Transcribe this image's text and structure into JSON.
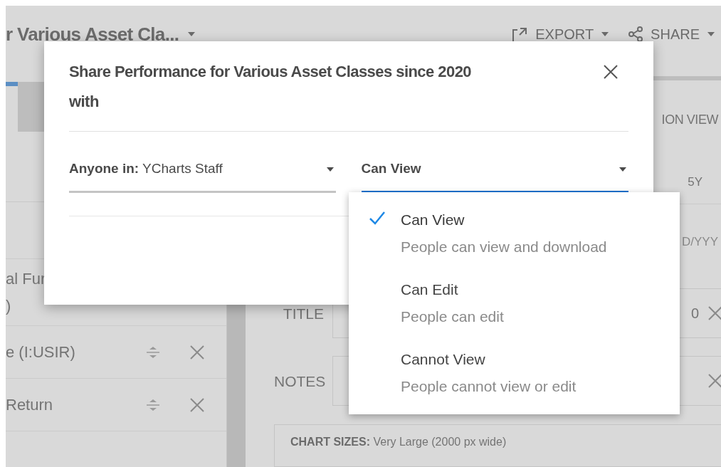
{
  "page": {
    "title": "r Various Asset Cla...",
    "actions": [
      {
        "kind": "export",
        "label": "EXPORT"
      },
      {
        "kind": "share",
        "label": "SHARE"
      }
    ]
  },
  "left_panel": {
    "rows": [
      {
        "lines": [
          "al Fur",
          ")"
        ],
        "controls": false
      },
      {
        "lines": [
          "e (I:USIR)"
        ],
        "controls": true
      },
      {
        "lines": [
          "Return"
        ],
        "controls": true
      }
    ]
  },
  "right_panel": {
    "view_label": "ION VIEW",
    "period": "5Y",
    "date_placeholder": "D/YYY",
    "fields": [
      {
        "label": "TITLE",
        "value": "0"
      },
      {
        "label": "NOTES"
      }
    ],
    "chart_sizes": {
      "label": "CHART SIZES:",
      "value": "Very Large (2000 px wide)"
    }
  },
  "dialog": {
    "title": "Share Performance for Various Asset Classes since 2020 with",
    "audience": {
      "label": "Anyone in:",
      "value": "YCharts Staff"
    },
    "permission": {
      "value": "Can View",
      "focused": true
    },
    "options": [
      {
        "label": "Can View",
        "description": "People can view and download",
        "selected": true
      },
      {
        "label": "Can Edit",
        "description": "People can edit",
        "selected": false
      },
      {
        "label": "Cannot View",
        "description": "People cannot view or edit",
        "selected": false
      }
    ]
  }
}
